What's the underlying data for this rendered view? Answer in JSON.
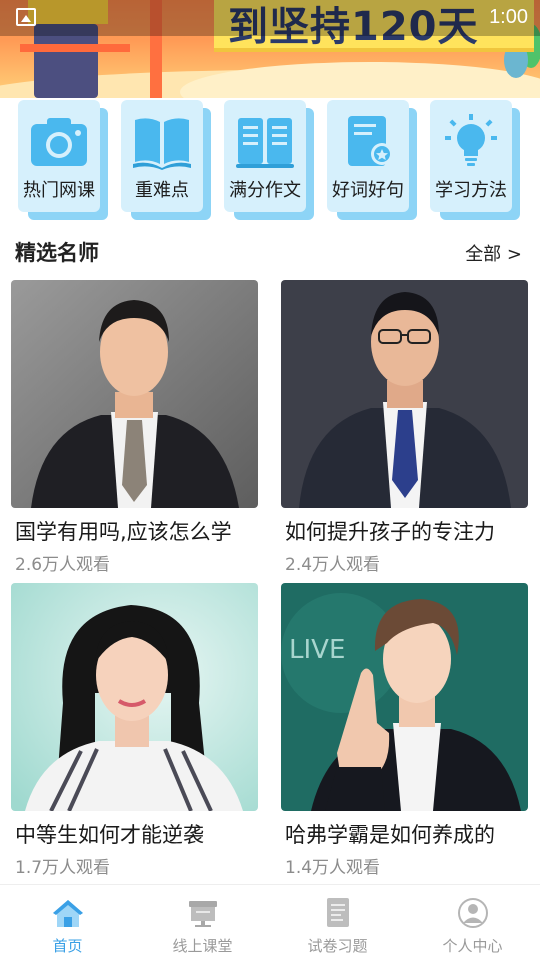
{
  "banner": {
    "slogan": "到坚持120天",
    "status_time": "1:00"
  },
  "categories": [
    {
      "label": "热门网课",
      "icon": "camera-icon"
    },
    {
      "label": "重难点",
      "icon": "open-book-icon"
    },
    {
      "label": "满分作文",
      "icon": "essay-book-icon"
    },
    {
      "label": "好词好句",
      "icon": "certificate-icon"
    },
    {
      "label": "学习方法",
      "icon": "lightbulb-icon"
    }
  ],
  "section": {
    "title": "精选名师",
    "see_all": "全部 >"
  },
  "teachers": [
    {
      "title": "国学有用吗,应该怎么学",
      "views": "2.6万人观看"
    },
    {
      "title": "如何提升孩子的专注力",
      "views": "2.4万人观看"
    },
    {
      "title": "中等生如何才能逆袭",
      "views": "1.7万人观看"
    },
    {
      "title": "哈弗学霸是如何养成的",
      "views": "1.4万人观看"
    }
  ],
  "photo_text": {
    "live": "LIVE"
  },
  "tabbar": [
    {
      "label": "首页",
      "icon": "home-icon",
      "active": true
    },
    {
      "label": "线上课堂",
      "icon": "blackboard-icon",
      "active": false
    },
    {
      "label": "试卷习题",
      "icon": "exam-paper-icon",
      "active": false
    },
    {
      "label": "个人中心",
      "icon": "user-icon",
      "active": false
    }
  ],
  "colors": {
    "accent": "#3aa0e6",
    "card_face": "#d6f0fc",
    "card_shadow": "#8dd4f6",
    "icon_blue": "#4ab8ee",
    "muted_text": "#8c8c8c"
  }
}
